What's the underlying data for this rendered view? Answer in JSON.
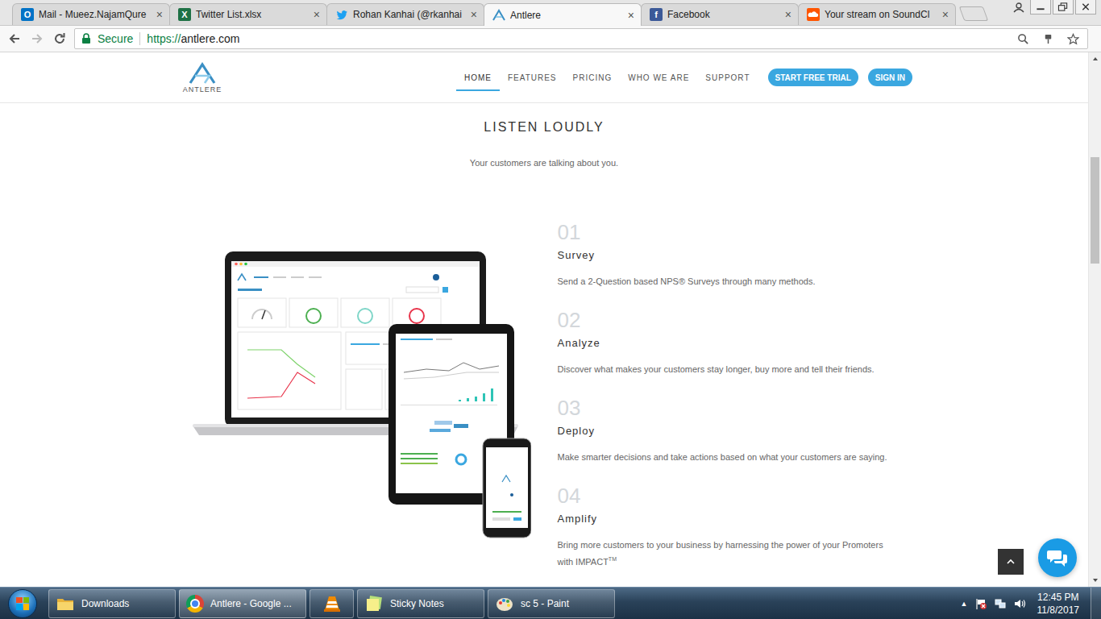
{
  "browser": {
    "tabs": [
      {
        "label": "Mail - Mueez.NajamQure",
        "selected": false,
        "kind": "outlook",
        "glyph": "O"
      },
      {
        "label": "Twitter List.xlsx",
        "selected": false,
        "kind": "excel",
        "glyph": "X"
      },
      {
        "label": "Rohan Kanhai (@rkanhai",
        "selected": false,
        "kind": "twitter",
        "glyph": ""
      },
      {
        "label": "Antlere",
        "selected": true,
        "kind": "antlere",
        "glyph": ""
      },
      {
        "label": "Facebook",
        "selected": false,
        "kind": "facebook",
        "glyph": "f"
      },
      {
        "label": "Your stream on SoundCl",
        "selected": false,
        "kind": "soundcloud",
        "glyph": ""
      }
    ],
    "tab_close": "×",
    "secure_label": "Secure",
    "url_scheme": "https://",
    "url_host": "antlere.com"
  },
  "site": {
    "logo_text": "ANTLERE",
    "nav": [
      {
        "label": "HOME",
        "selected": true
      },
      {
        "label": "FEATURES",
        "selected": false
      },
      {
        "label": "PRICING",
        "selected": false
      },
      {
        "label": "WHO WE ARE",
        "selected": false
      },
      {
        "label": "SUPPORT",
        "selected": false
      }
    ],
    "buttons": [
      "START FREE TRIAL",
      "SIGN IN"
    ],
    "title": "LISTEN LOUDLY",
    "subtitle": "Your customers are talking about you.",
    "steps": [
      {
        "number": "01",
        "title": "Survey",
        "text": "Send a 2-Question based NPS® Surveys through many methods."
      },
      {
        "number": "02",
        "title": "Analyze",
        "text": "Discover what makes your customers stay longer, buy more and tell their friends."
      },
      {
        "number": "03",
        "title": "Deploy",
        "text": "Make smarter decisions and take actions based on what your customers are saying."
      },
      {
        "number": "04",
        "title": "Amplify",
        "text": "Bring more customers to your business by harnessing the power of your Promoters with IMPACT",
        "sup": "TM"
      }
    ]
  },
  "scrollbar": {
    "thumb_start": 0.18,
    "thumb_size": 0.21
  },
  "taskbar": {
    "items": [
      {
        "label": "Downloads",
        "kind": "explorer",
        "selected": false
      },
      {
        "label": "Antlere - Google ...",
        "kind": "chrome",
        "selected": true
      },
      {
        "label": "",
        "kind": "vlc",
        "selected": false
      },
      {
        "label": "Sticky Notes",
        "kind": "sticky",
        "selected": false
      },
      {
        "label": "sc 5 - Paint",
        "kind": "paint",
        "selected": false
      }
    ],
    "tray": {
      "overflow": "▲",
      "time": "12:45 PM",
      "date": "11/8/2017"
    }
  }
}
